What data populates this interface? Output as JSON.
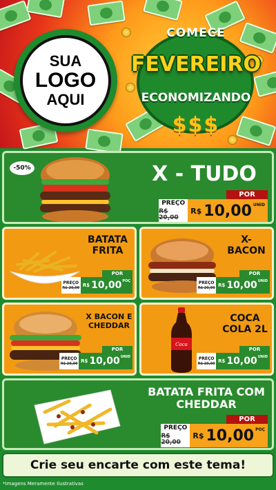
{
  "header": {
    "logo": {
      "line1": "SUA",
      "line2": "LOGO",
      "line3": "AQUI"
    },
    "promo": {
      "comece": "COMECE",
      "fevereiro": "FEVEREIRO",
      "economizando": "ECONOMIZANDO",
      "symbols": "$$$"
    }
  },
  "items": [
    {
      "name": "X - TUDO",
      "discount": "-50%",
      "price_label": "PREÇO",
      "old_price": "R$ 20,00",
      "por": "POR",
      "currency": "R$",
      "price": "10,00",
      "unit": "UNID"
    },
    {
      "name_l1": "BATATA",
      "name_l2": "FRITA",
      "price_label": "PREÇO",
      "old_price": "R$ 20,00",
      "por": "POR",
      "currency": "R$",
      "price": "10,00",
      "unit": "POÇ"
    },
    {
      "name_l1": "X-",
      "name_l2": "BACON",
      "price_label": "PREÇO",
      "old_price": "R$ 20,00",
      "por": "POR",
      "currency": "R$",
      "price": "10,00",
      "unit": "UNID"
    },
    {
      "name_l1": "X BACON E",
      "name_l2": "CHEDDAR",
      "price_label": "PREÇO",
      "old_price": "R$ 20,00",
      "por": "POR",
      "currency": "R$",
      "price": "10,00",
      "unit": "UNID"
    },
    {
      "name_l1": "COCA",
      "name_l2": "COLA 2L",
      "price_label": "PREÇO",
      "old_price": "R$ 20,00",
      "por": "POR",
      "currency": "R$",
      "price": "10,00",
      "unit": "UNID"
    },
    {
      "name_l1": "BATATA FRITA COM",
      "name_l2": "CHEDDAR",
      "price_label": "PREÇO",
      "old_price": "R$ 20,00",
      "por": "POR",
      "currency": "R$",
      "price": "10,00",
      "unit": "POÇ"
    }
  ],
  "footer": {
    "cta": "Crie seu encarte com este tema!",
    "note": "*Imagens Meramente Ilustrativas"
  },
  "colors": {
    "green": "#2a8a2e",
    "orange": "#f29a12",
    "red": "#b5110f",
    "yellow": "#ffd21a"
  },
  "icons": [
    "money-bill-icon",
    "coin-icon",
    "burger-image",
    "fries-image",
    "soda-bottle-image"
  ]
}
